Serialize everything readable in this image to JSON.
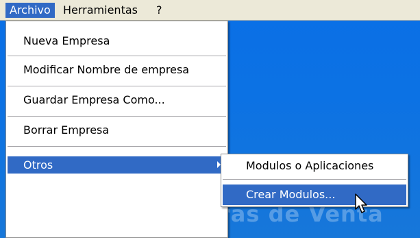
{
  "menubar": {
    "items": [
      {
        "label": "Archivo"
      },
      {
        "label": "Herramientas"
      },
      {
        "label": "?"
      }
    ]
  },
  "archivo_menu": {
    "items": [
      {
        "label": "Nueva Empresa"
      },
      {
        "label": "Modificar Nombre de empresa"
      },
      {
        "label": "Guardar Empresa Como..."
      },
      {
        "label": "Borrar Empresa"
      },
      {
        "label": "Otros"
      }
    ]
  },
  "otros_submenu": {
    "items": [
      {
        "label": "Modulos o Aplicaciones"
      },
      {
        "label": "Crear Modulos..."
      }
    ]
  },
  "background": {
    "text": "ras de Venta"
  },
  "colors": {
    "highlight": "#316ac5",
    "menubar": "#ece9d8",
    "desktop": "#0c72e4"
  },
  "icons": {
    "submenu_arrow": "triangle-right",
    "cursor": "arrow-pointer"
  }
}
